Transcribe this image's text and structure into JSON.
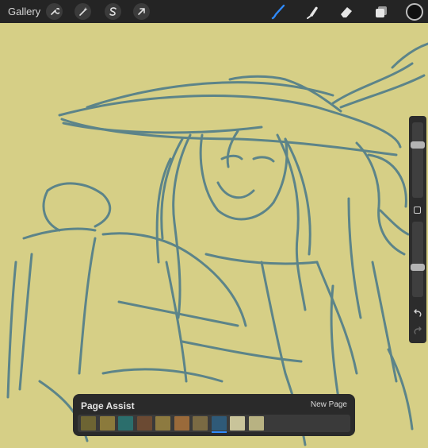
{
  "topbar": {
    "gallery_label": "Gallery",
    "tools_left": [
      {
        "name": "actions",
        "icon": "wrench-icon"
      },
      {
        "name": "adjustments",
        "icon": "magic-wand-icon"
      },
      {
        "name": "selection",
        "icon": "selection-s-icon"
      },
      {
        "name": "transform",
        "icon": "transform-arrow-icon"
      }
    ],
    "tools_right": [
      {
        "name": "brush",
        "icon": "brush-icon",
        "active": true
      },
      {
        "name": "smudge",
        "icon": "smudge-icon"
      },
      {
        "name": "eraser",
        "icon": "eraser-icon"
      },
      {
        "name": "layers",
        "icon": "layers-icon"
      }
    ],
    "current_color": "#111111",
    "accent_color": "#2f8bff"
  },
  "sidebar": {
    "brush_size_level": 0.28,
    "opacity_level": 0.62
  },
  "page_assist": {
    "title": "Page Assist",
    "new_page_label": "New Page",
    "page_count": 10,
    "selected_page": 8,
    "thumbnails": [
      "#6d6433",
      "#8b7a3c",
      "#2b6e6c",
      "#6b4a33",
      "#8d7a40",
      "#9a6a3a",
      "#7a6a43",
      "#2f5a78",
      "#c9c49a",
      "#b8b282"
    ]
  },
  "canvas": {
    "background": "#d6cf86",
    "stroke_color": "#4f7c8a"
  }
}
